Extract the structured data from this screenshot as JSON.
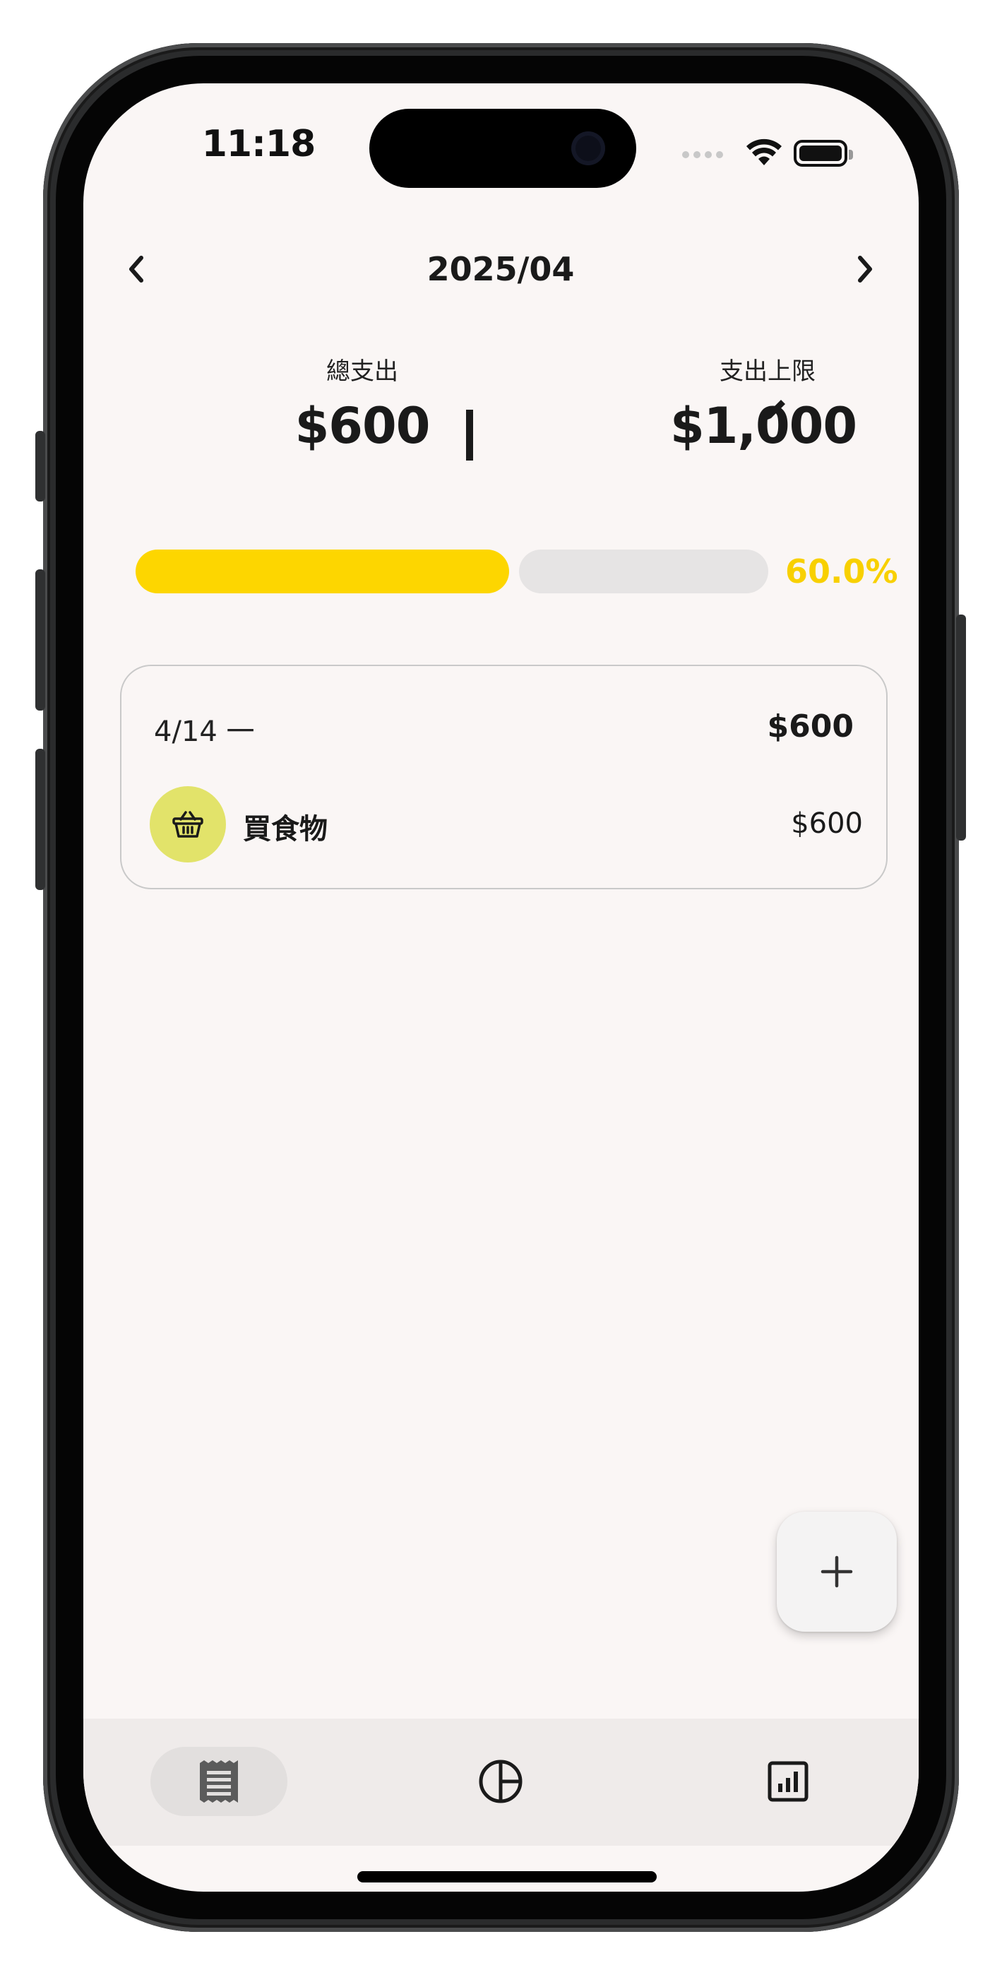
{
  "status_bar": {
    "time": "11:18",
    "icons": [
      "cellular-dots-icon",
      "wifi-icon",
      "battery-icon"
    ]
  },
  "header": {
    "month": "2025/04",
    "prev_icon": "chevron-left-icon",
    "next_icon": "chevron-right-icon"
  },
  "summary": {
    "total_label": "總支出",
    "total_value": "$600",
    "limit_label": "支出上限",
    "limit_value": "$1,000",
    "edit_icon": "pencil-icon"
  },
  "progress": {
    "fraction": 0.6,
    "percent_text": "60.0%",
    "fill_color": "#fdd600",
    "track_color": "#e6e4e4"
  },
  "days": [
    {
      "date": "4/14 一",
      "total": "$600",
      "items": [
        {
          "name": "買食物",
          "amount": "$600",
          "icon": "basket-icon",
          "icon_bg": "#e2e36a"
        }
      ]
    }
  ],
  "fab": {
    "icon": "plus-icon"
  },
  "tabs": [
    {
      "icon": "receipt-icon",
      "active": true
    },
    {
      "icon": "pie-chart-icon",
      "active": false
    },
    {
      "icon": "bar-chart-icon",
      "active": false
    }
  ],
  "colors": {
    "accent": "#fdd600",
    "background": "#faf6f5",
    "tab_bar": "#efebea"
  }
}
